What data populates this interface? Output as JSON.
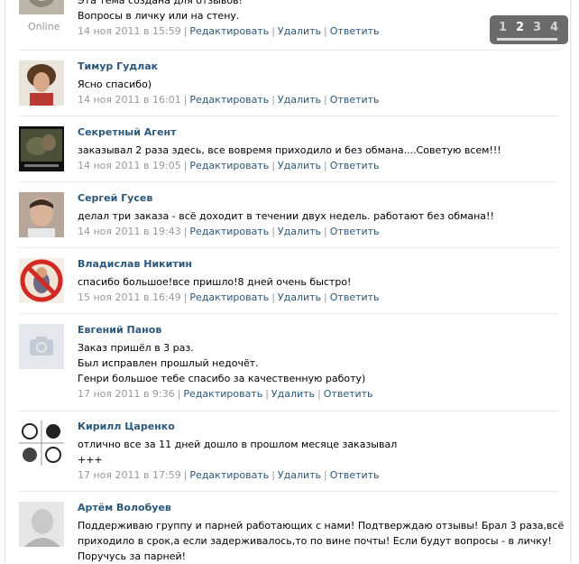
{
  "first_post": {
    "line1": "Эта тема создана для отзывов!",
    "line2": "Вопросы в личку или на стену.",
    "online": "Online",
    "date": "14 ноя 2011 в 15:59"
  },
  "actions": {
    "edit": "Редактировать",
    "delete": "Удалить",
    "reply": "Ответить"
  },
  "pager": {
    "pages": [
      "1",
      "2",
      "3",
      "4"
    ],
    "current": "2"
  },
  "posts": [
    {
      "author": "Тимур Гудлак",
      "lines": [
        "Ясно спасибо)"
      ],
      "date": "14 ноя 2011 в 16:01"
    },
    {
      "author": "Секретный Агент",
      "lines": [
        "заказывал 2 раза здесь, все вовремя приходило и без обмана....Советую всем!!!"
      ],
      "date": "14 ноя 2011 в 19:05"
    },
    {
      "author": "Сергей Гусев",
      "lines": [
        "делал три заказа - всё доходит в течении двух недель. работают без обмана!!"
      ],
      "date": "14 ноя 2011 в 19:43"
    },
    {
      "author": "Владислав Никитин",
      "lines": [
        "спасибо большое!все пришло!8 дней очень быстро!"
      ],
      "date": "15 ноя 2011 в 16:49"
    },
    {
      "author": "Евгений Панов",
      "lines": [
        "Заказ пришёл в 3 раз.",
        "Был исправлен прошлый недочёт.",
        "Генри большое тебе спасибо за качественную работу)"
      ],
      "date": "17 ноя 2011 в 9:36"
    },
    {
      "author": "Кирилл Царенко",
      "lines": [
        "отлично все за 11 дней дошло в прошлом месяце заказывал",
        "+++"
      ],
      "date": "17 ноя 2011 в 17:59"
    },
    {
      "author": "Артём Волобуев",
      "lines": [
        "Поддерживаю группу и парней работающих с нами! Подтверждаю отзывы! Брал 3 раза,всё",
        "приходило в срок,а если задерживалось,то по вине почты! Если будут вопросы - в личку!",
        "Поручусь за парней!"
      ],
      "date": ""
    }
  ]
}
